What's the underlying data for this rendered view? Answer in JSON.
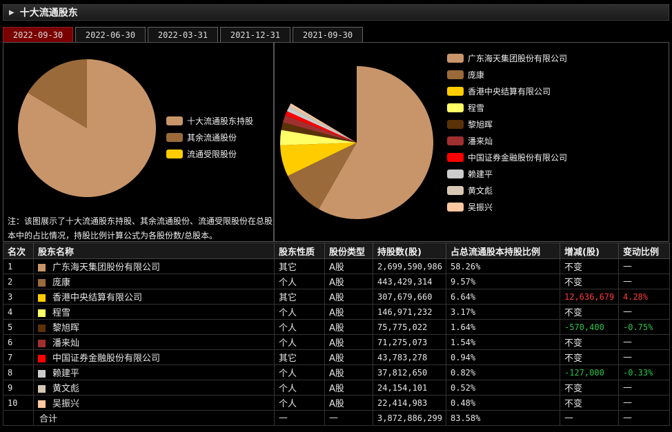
{
  "header": {
    "title": "十大流通股东"
  },
  "tabs": [
    "2022-09-30",
    "2022-06-30",
    "2022-03-31",
    "2021-12-31",
    "2021-09-30"
  ],
  "active_tab": 0,
  "left_chart": {
    "legend": [
      {
        "label": "十大流通股东持股",
        "color": "#c8956a"
      },
      {
        "label": "其余流通股份",
        "color": "#9a6a3a"
      },
      {
        "label": "流通受限股份",
        "color": "#ffcc00"
      }
    ],
    "note": "注：该图展示了十大流通股东持股、其余流通股份、流通受限股份在总股本中的占比情况，持股比例计算公式为各股份数/总股本。"
  },
  "right_chart": {
    "legend": [
      {
        "label": "广东海天集团股份有限公司",
        "color": "#c8956a"
      },
      {
        "label": "庞康",
        "color": "#9a6a3a"
      },
      {
        "label": "香港中央结算有限公司",
        "color": "#ffcc00"
      },
      {
        "label": "程雪",
        "color": "#ffff66"
      },
      {
        "label": "黎旭晖",
        "color": "#5a3208"
      },
      {
        "label": "潘来灿",
        "color": "#a03030"
      },
      {
        "label": "中国证券金融股份有限公司",
        "color": "#ff0000"
      },
      {
        "label": "赖建平",
        "color": "#cccccc"
      },
      {
        "label": "黄文彪",
        "color": "#d6c8b4"
      },
      {
        "label": "吴振兴",
        "color": "#ffc8a0"
      }
    ]
  },
  "chart_data": [
    {
      "type": "pie",
      "categories": [
        "十大流通股东持股",
        "其余流通股份",
        "流通受限股份"
      ],
      "values": [
        83.58,
        16.42,
        0
      ],
      "colors": [
        "#c8956a",
        "#9a6a3a",
        "#ffcc00"
      ]
    },
    {
      "type": "pie",
      "categories": [
        "广东海天集团股份有限公司",
        "庞康",
        "香港中央结算有限公司",
        "程雪",
        "黎旭晖",
        "潘来灿",
        "中国证券金融股份有限公司",
        "赖建平",
        "黄文彪",
        "吴振兴"
      ],
      "values": [
        58.26,
        9.57,
        6.64,
        3.17,
        1.64,
        1.54,
        0.94,
        0.82,
        0.52,
        0.48
      ],
      "colors": [
        "#c8956a",
        "#9a6a3a",
        "#ffcc00",
        "#ffff66",
        "#5a3208",
        "#a03030",
        "#ff0000",
        "#cccccc",
        "#d6c8b4",
        "#ffc8a0"
      ]
    }
  ],
  "table": {
    "headers": [
      "名次",
      "股东名称",
      "股东性质",
      "股份类型",
      "持股数(股)",
      "占总流通股本持股比例",
      "增减(股)",
      "变动比例"
    ],
    "rows": [
      {
        "rank": "1",
        "color": "#c8956a",
        "name": "广东海天集团股份有限公司",
        "nature": "其它",
        "type": "A股",
        "shares": "2,699,590,986",
        "ratio": "58.26%",
        "change": "不变",
        "change_pct": "—",
        "trend": ""
      },
      {
        "rank": "2",
        "color": "#9a6a3a",
        "name": "庞康",
        "nature": "个人",
        "type": "A股",
        "shares": "443,429,314",
        "ratio": "9.57%",
        "change": "不变",
        "change_pct": "—",
        "trend": ""
      },
      {
        "rank": "3",
        "color": "#ffcc00",
        "name": "香港中央结算有限公司",
        "nature": "其它",
        "type": "A股",
        "shares": "307,679,660",
        "ratio": "6.64%",
        "change": "12,636,679",
        "change_pct": "4.28%",
        "trend": "up"
      },
      {
        "rank": "4",
        "color": "#ffff66",
        "name": "程雪",
        "nature": "个人",
        "type": "A股",
        "shares": "146,971,232",
        "ratio": "3.17%",
        "change": "不变",
        "change_pct": "—",
        "trend": ""
      },
      {
        "rank": "5",
        "color": "#5a3208",
        "name": "黎旭晖",
        "nature": "个人",
        "type": "A股",
        "shares": "75,775,022",
        "ratio": "1.64%",
        "change": "-570,400",
        "change_pct": "-0.75%",
        "trend": "down"
      },
      {
        "rank": "6",
        "color": "#a03030",
        "name": "潘来灿",
        "nature": "个人",
        "type": "A股",
        "shares": "71,275,073",
        "ratio": "1.54%",
        "change": "不变",
        "change_pct": "—",
        "trend": ""
      },
      {
        "rank": "7",
        "color": "#ff0000",
        "name": "中国证券金融股份有限公司",
        "nature": "其它",
        "type": "A股",
        "shares": "43,783,278",
        "ratio": "0.94%",
        "change": "不变",
        "change_pct": "—",
        "trend": ""
      },
      {
        "rank": "8",
        "color": "#cccccc",
        "name": "赖建平",
        "nature": "个人",
        "type": "A股",
        "shares": "37,812,650",
        "ratio": "0.82%",
        "change": "-127,000",
        "change_pct": "-0.33%",
        "trend": "down"
      },
      {
        "rank": "9",
        "color": "#d6c8b4",
        "name": "黄文彪",
        "nature": "个人",
        "type": "A股",
        "shares": "24,154,101",
        "ratio": "0.52%",
        "change": "不变",
        "change_pct": "—",
        "trend": ""
      },
      {
        "rank": "10",
        "color": "#ffc8a0",
        "name": "吴振兴",
        "nature": "个人",
        "type": "A股",
        "shares": "22,414,983",
        "ratio": "0.48%",
        "change": "不变",
        "change_pct": "—",
        "trend": ""
      }
    ],
    "total": {
      "label": "合计",
      "nature": "—",
      "type": "—",
      "shares": "3,872,886,299",
      "ratio": "83.58%",
      "change": "—",
      "change_pct": "—"
    }
  }
}
